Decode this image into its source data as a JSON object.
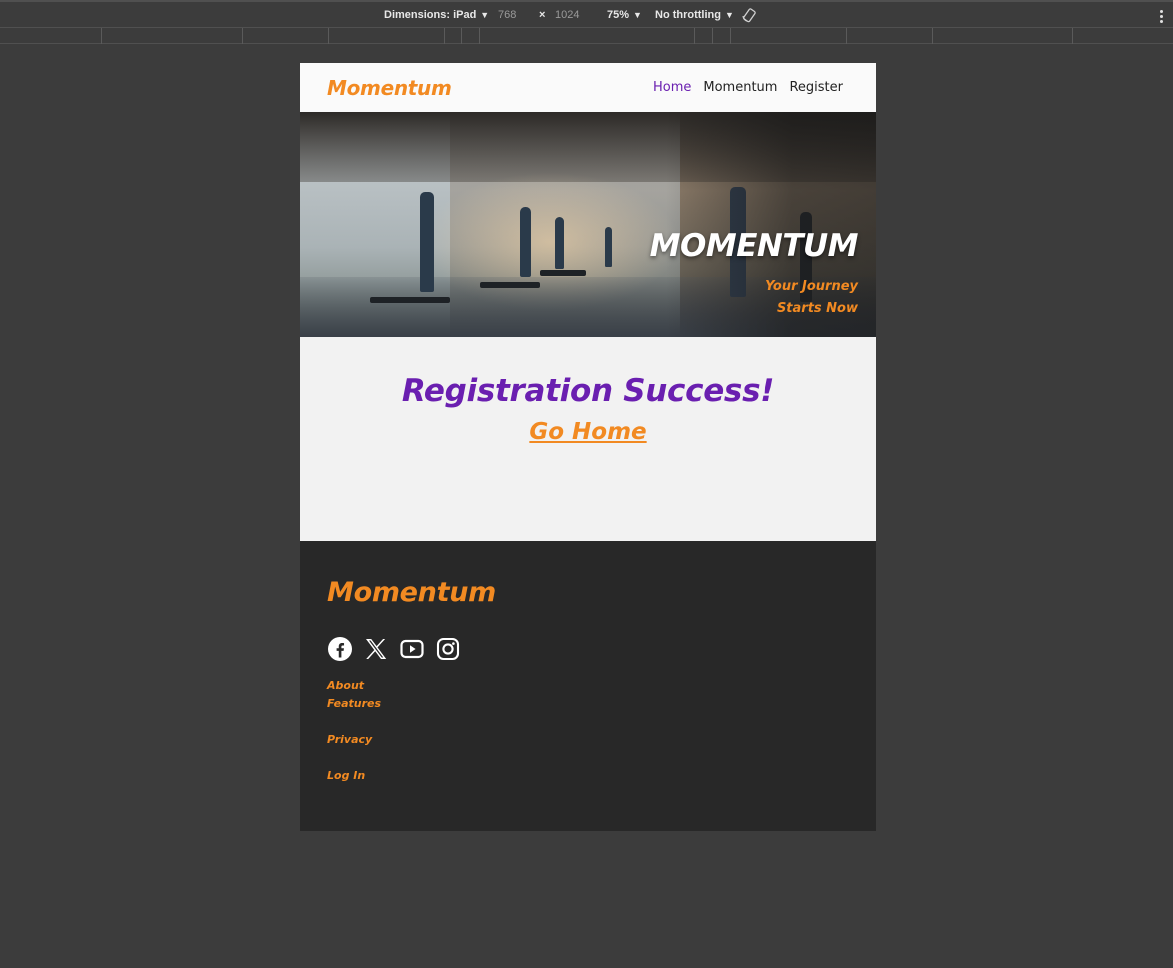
{
  "devtools": {
    "dimensions_label": "Dimensions: iPad",
    "width": "768",
    "times": "×",
    "height": "1024",
    "zoom": "75%",
    "throttling": "No throttling"
  },
  "nav": {
    "brand": "Momentum",
    "links": [
      {
        "label": "Home",
        "active": true
      },
      {
        "label": "Momentum",
        "active": false
      },
      {
        "label": "Register",
        "active": false
      }
    ]
  },
  "hero": {
    "title": "MOMENTUM",
    "subtitle_line1": "Your Journey",
    "subtitle_line2": "Starts Now"
  },
  "main": {
    "heading": "Registration Success!",
    "go_home": "Go Home"
  },
  "footer": {
    "brand": "Momentum",
    "social_icons": [
      "facebook-icon",
      "x-icon",
      "youtube-icon",
      "instagram-icon"
    ],
    "links": [
      "About",
      "Features",
      "Privacy",
      "Log In"
    ]
  },
  "colors": {
    "accent_orange": "#f28a22",
    "accent_purple": "#6a1fb0",
    "footer_bg": "#282828",
    "page_bg": "#f2f2f2"
  }
}
